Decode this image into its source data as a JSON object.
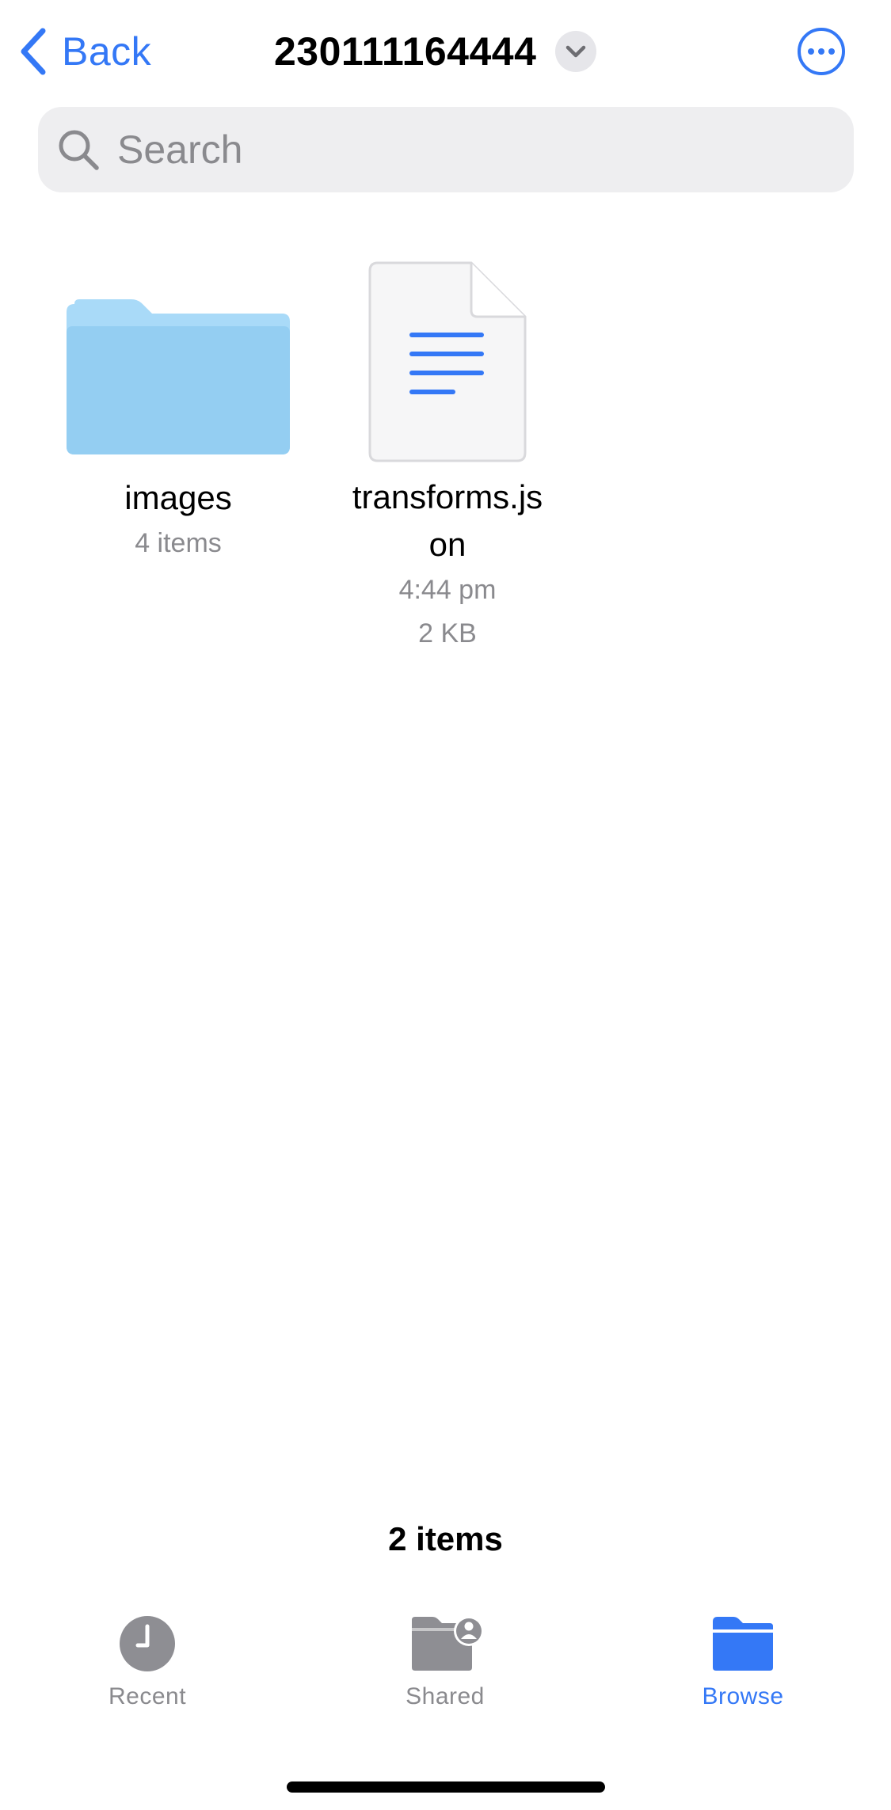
{
  "nav": {
    "back_label": "Back",
    "title": "230111164444"
  },
  "search": {
    "placeholder": "Search"
  },
  "items": [
    {
      "name": "images",
      "meta": [
        "4 items"
      ],
      "kind": "folder-icon"
    },
    {
      "name": "transforms.js\non",
      "meta": [
        "4:44 pm",
        "2 KB"
      ],
      "kind": "text-document-icon"
    }
  ],
  "footer": {
    "count": "2 items"
  },
  "tabs": [
    {
      "label": "Recent",
      "icon": "clock-icon",
      "active": false
    },
    {
      "label": "Shared",
      "icon": "shared-folder-icon",
      "active": false
    },
    {
      "label": "Browse",
      "icon": "folder-icon",
      "active": true
    }
  ],
  "colors": {
    "accent": "#3478f6",
    "folder": "#9bd3f5",
    "secondary_text": "#8a8a8e",
    "search_bg": "#eeeef0",
    "tab_inactive": "#8e8e93"
  }
}
